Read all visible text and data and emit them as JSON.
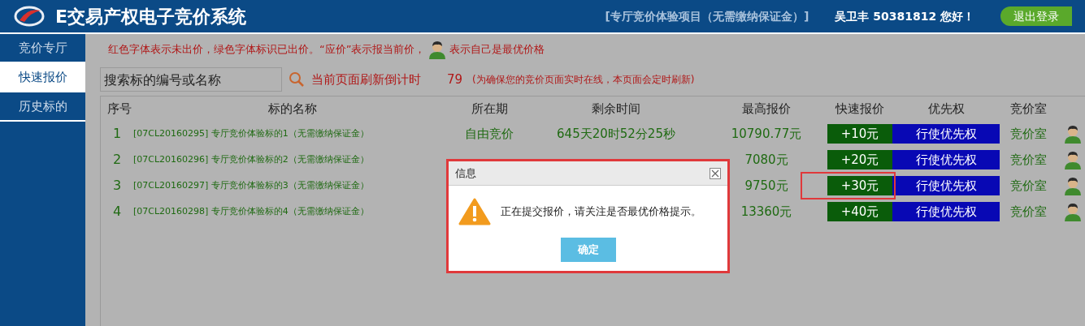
{
  "header": {
    "title": "E交易产权电子竞价系统",
    "project": "[专厅竞价体验项目（无需缴纳保证金）]",
    "greeting": "吴卫丰 50381812 您好！",
    "logout": "退出登录"
  },
  "sidebar": {
    "items": [
      {
        "label": "竞价专厅",
        "selected": false
      },
      {
        "label": "快速报价",
        "selected": true
      },
      {
        "label": "历史标的",
        "selected": false
      }
    ]
  },
  "legend": {
    "text": "红色字体表示未出价，绿色字体标识已出价。“应价”表示报当前价，",
    "suffix": "表示自己是最优价格"
  },
  "search": {
    "placeholder": "搜索标的编号或名称"
  },
  "refresh": {
    "label": "当前页面刷新倒计时",
    "count": "79",
    "note": "(为确保您的竞价页面实时在线，本页面会定时刷新)"
  },
  "table": {
    "columns": [
      "序号",
      "标的名称",
      "所在期",
      "剩余时间",
      "最高报价",
      "快速报价",
      "优先权",
      "竞价室"
    ],
    "rows": [
      {
        "index": "1",
        "name": "[07CL20160295] 专厅竞价体验标的1（无需缴纳保证金）",
        "period": "自由竞价",
        "remaining": "645天20时52分25秒",
        "price": "10790.77元",
        "quick": "+10元",
        "priority": "行使优先权",
        "room": "竞价室",
        "highlighted": false
      },
      {
        "index": "2",
        "name": "[07CL20160296] 专厅竞价体验标的2（无需缴纳保证金）",
        "price": "7080元",
        "quick": "+20元",
        "priority": "行使优先权",
        "room": "竞价室",
        "highlighted": false
      },
      {
        "index": "3",
        "name": "[07CL20160297] 专厅竞价体验标的3（无需缴纳保证金）",
        "price": "9750元",
        "quick": "+30元",
        "priority": "行使优先权",
        "room": "竞价室",
        "highlighted": true
      },
      {
        "index": "4",
        "name": "[07CL20160298] 专厅竞价体验标的4（无需缴纳保证金）",
        "price": "13360元",
        "quick": "+40元",
        "priority": "行使优先权",
        "room": "竞价室",
        "highlighted": false
      }
    ]
  },
  "dialog": {
    "title": "信息",
    "message": "正在提交报价，请关注是否最优价格提示。",
    "ok": "确定"
  }
}
